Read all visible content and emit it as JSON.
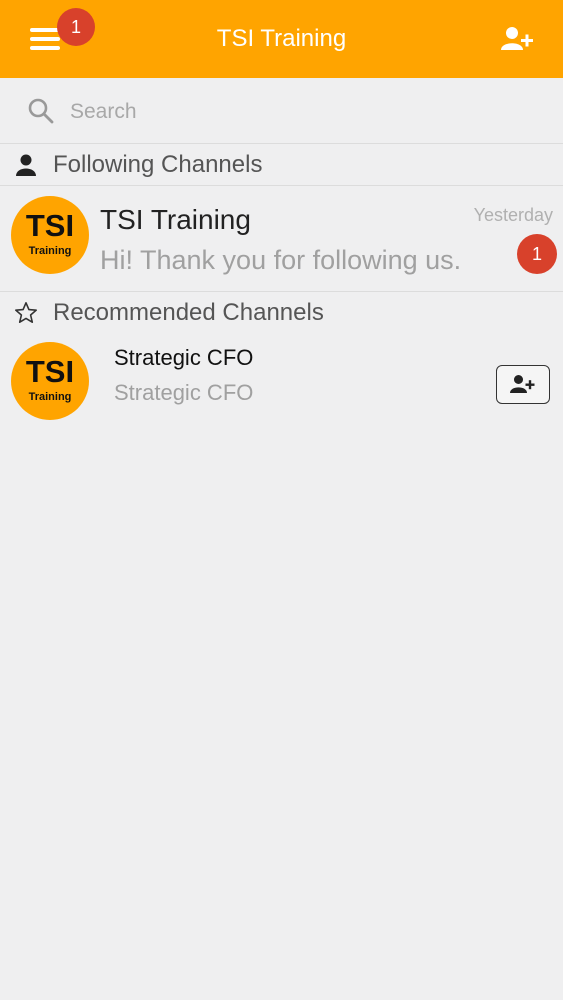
{
  "header": {
    "title": "TSI Training",
    "menu_badge": "1",
    "icons": {
      "menu": "hamburger-icon",
      "add_user": "add-user-icon"
    },
    "color": "#ffa400"
  },
  "search": {
    "placeholder": "Search"
  },
  "following": {
    "section_label": "Following Channels",
    "channels": [
      {
        "avatar_text": "TSI",
        "avatar_subtext": "Training",
        "name": "TSI Training",
        "last_message": "Hi! Thank you for following us.",
        "timestamp": "Yesterday",
        "unread_count": "1"
      }
    ]
  },
  "recommended": {
    "section_label": "Recommended Channels",
    "channels": [
      {
        "avatar_text": "TSI",
        "avatar_subtext": "Training",
        "name": "Strategic CFO",
        "subtitle": "Strategic CFO"
      }
    ]
  },
  "colors": {
    "accent": "#ffa400",
    "badge": "#d8412b",
    "background": "#efeff0"
  }
}
